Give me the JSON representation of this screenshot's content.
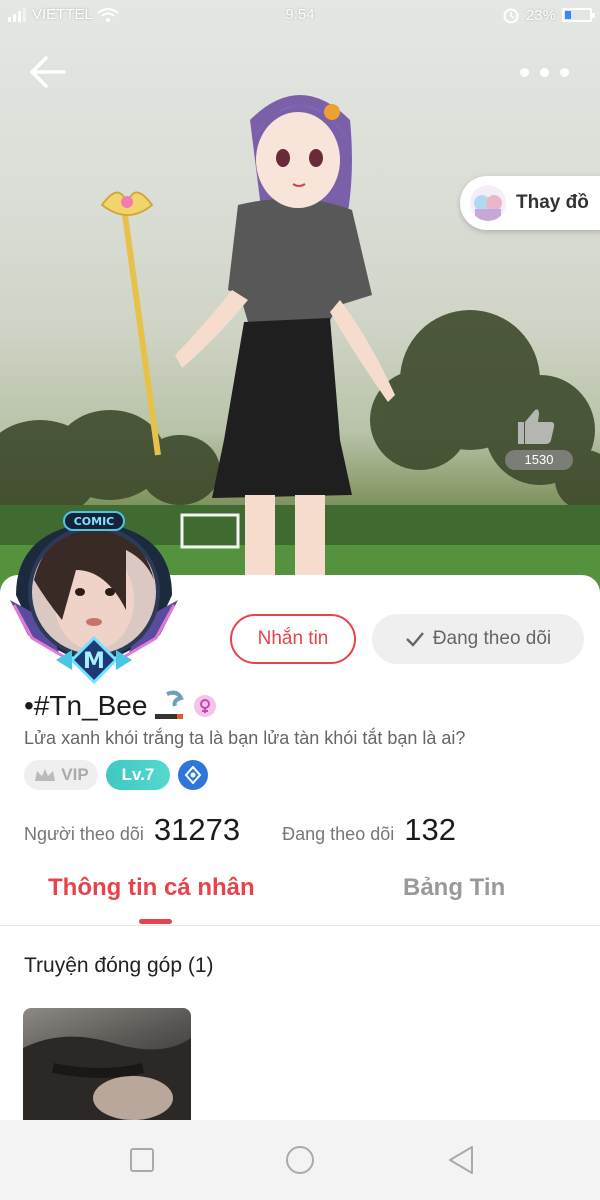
{
  "status_bar": {
    "carrier": "VIETTEL",
    "time": "9:54",
    "battery_percent": "23%",
    "battery_level": 0.23,
    "icons": [
      "signal-icon",
      "wifi-icon",
      "alarm-icon",
      "battery-icon"
    ]
  },
  "header": {
    "back_icon": "arrow-left-icon",
    "more_icon": "more-dots-icon",
    "change_outfit_label": "Thay đồ",
    "like_count": "1530"
  },
  "avatar": {
    "frame_badge_text": "COMIC",
    "frame_emblem_letter": "M"
  },
  "actions": {
    "message_label": "Nhắn tin",
    "following_label": "Đang theo dõi"
  },
  "profile": {
    "username": "•#Tn_Bee",
    "bio": "Lửa xanh khói trắng ta là bạn lửa tàn khói tắt bạn là ai?",
    "gender_icon": "female-icon"
  },
  "badges": {
    "vip_label": "VIP",
    "level_label": "Lv.7"
  },
  "stats": {
    "followers_label": "Người theo dõi",
    "followers_value": "31273",
    "following_label": "Đang theo dõi",
    "following_value": "132"
  },
  "tabs": [
    {
      "label": "Thông tin cá nhân",
      "active": true
    },
    {
      "label": "Bảng Tin",
      "active": false
    }
  ],
  "contributions": {
    "title": "Truyện đóng góp (1)"
  },
  "colors": {
    "accent": "#e8434a",
    "level_badge": "#3ec9c1",
    "nav_bg": "#f3f3f3"
  }
}
